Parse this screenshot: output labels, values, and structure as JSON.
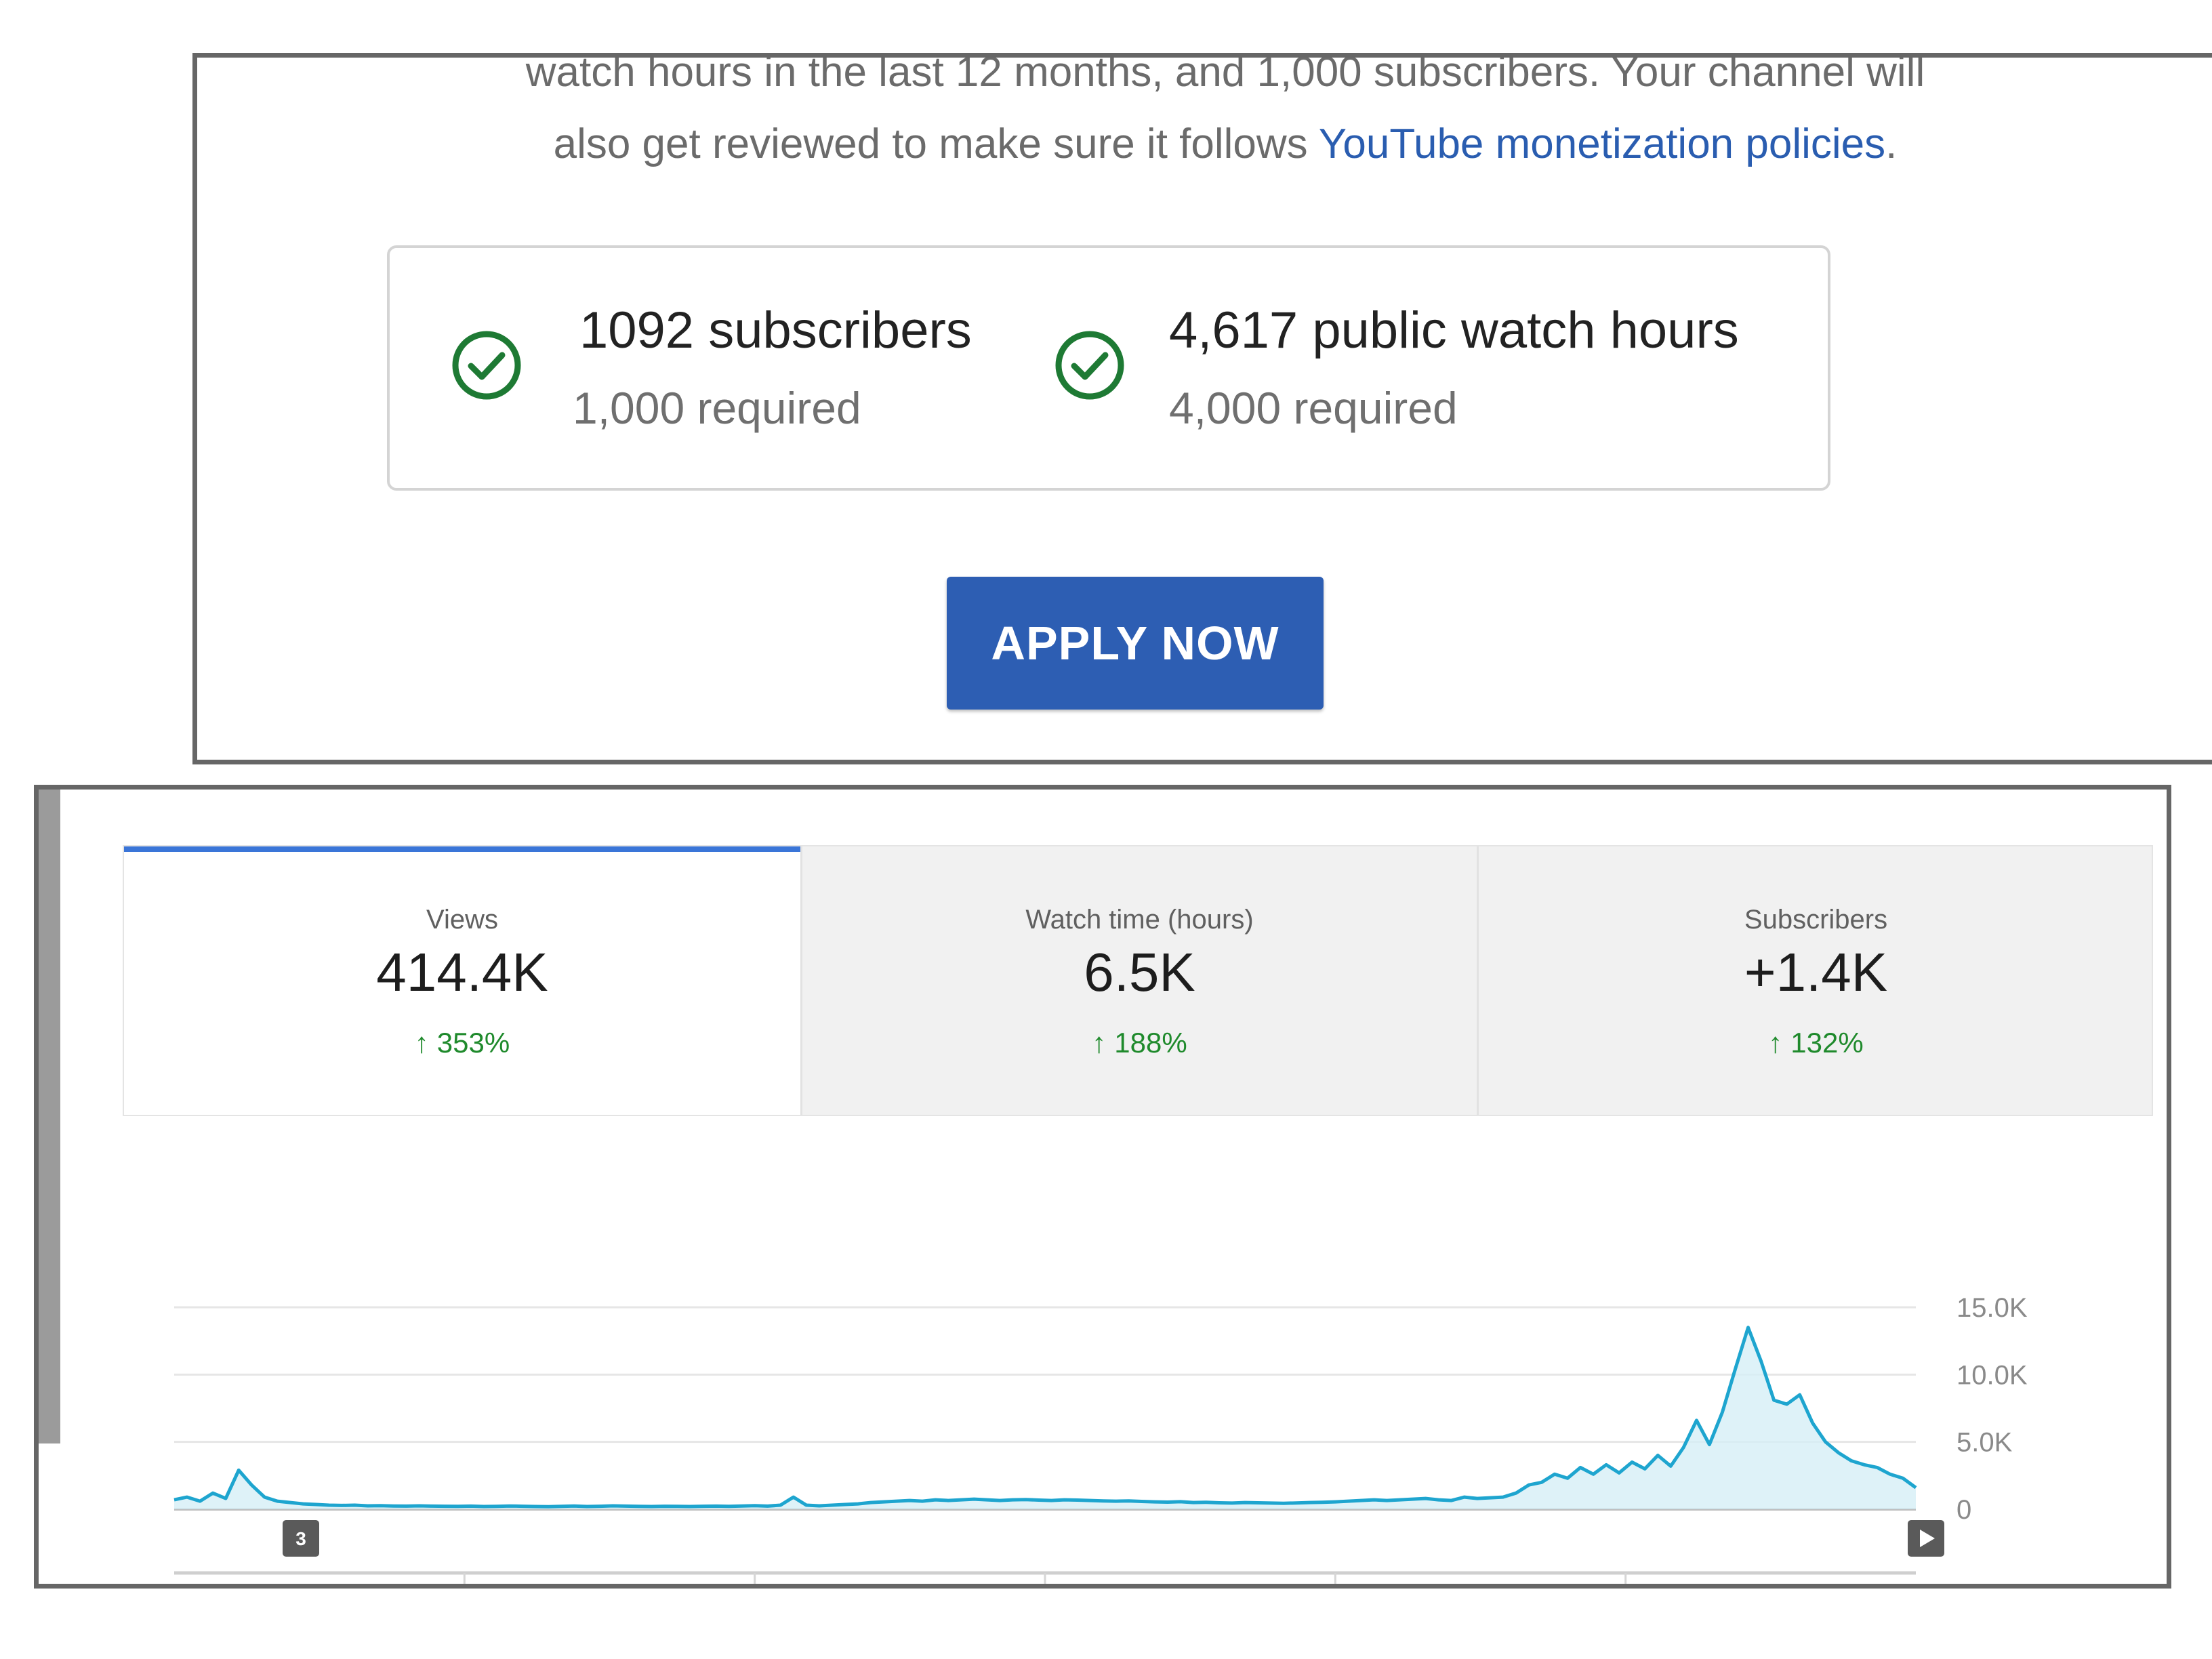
{
  "intro": {
    "line1": "watch hours in the last 12 months, and 1,000 subscribers. Your channel will",
    "line2_prefix": "also get reviewed to make sure it follows ",
    "policy_link": "YouTube monetization policies",
    "line2_suffix": "."
  },
  "requirements": {
    "subscribers": {
      "count": "1092",
      "label": "subscribers",
      "required": "1,000 required",
      "met": true
    },
    "watch_hours": {
      "count": "4,617",
      "label": "public watch hours",
      "required": "4,000 required",
      "met": true
    }
  },
  "apply_button": {
    "label": "APPLY NOW"
  },
  "metric_tabs": [
    {
      "label": "Views",
      "value": "414.4K",
      "change": "353%",
      "selected": true
    },
    {
      "label": "Watch time (hours)",
      "value": "6.5K",
      "change": "188%",
      "selected": false
    },
    {
      "label": "Subscribers",
      "value": "+1.4K",
      "change": "132%",
      "selected": false
    }
  ],
  "chart_markers": {
    "left_badge": "3"
  },
  "colors": {
    "accent_blue": "#2d5eb3",
    "tab_indicator": "#3a75d8",
    "positive_green": "#1f8a2c",
    "check_green": "#1e7a34",
    "chart_line": "#1ea5cf",
    "chart_fill": "#d6eff6"
  },
  "icons": {
    "check": "check-circle-icon",
    "delta": "arrow-up-icon",
    "play": "play-icon"
  },
  "chart_data": {
    "type": "area",
    "title": "",
    "xlabel": "",
    "ylabel": "",
    "yticks": [
      "0",
      "5.0K",
      "10.0K",
      "15.0K"
    ],
    "ylim": [
      0,
      15000
    ],
    "grid": true,
    "y_axis_side": "right",
    "series": [
      {
        "values": [
          700,
          900,
          600,
          1200,
          800,
          2900,
          1800,
          900,
          600,
          500,
          400,
          350,
          300,
          280,
          300,
          250,
          260,
          240,
          230,
          250,
          230,
          220,
          210,
          230,
          200,
          210,
          240,
          220,
          200,
          190,
          210,
          240,
          200,
          220,
          250,
          230,
          210,
          200,
          220,
          210,
          200,
          220,
          230,
          210,
          240,
          260,
          230,
          300,
          900,
          300,
          250,
          300,
          350,
          400,
          500,
          550,
          600,
          650,
          600,
          700,
          650,
          700,
          750,
          700,
          650,
          700,
          720,
          680,
          650,
          700,
          680,
          650,
          620,
          600,
          620,
          580,
          550,
          530,
          560,
          500,
          520,
          480,
          460,
          500,
          480,
          460,
          440,
          470,
          500,
          520,
          550,
          600,
          650,
          700,
          650,
          700,
          750,
          800,
          700,
          650,
          900,
          800,
          850,
          900,
          1200,
          1800,
          2000,
          2600,
          2300,
          3100,
          2600,
          3300,
          2700,
          3500,
          3000,
          4000,
          3200,
          4600,
          6600,
          4800,
          7200,
          10400,
          13500,
          11000,
          8100,
          7800,
          8500,
          6400,
          5000,
          4200,
          3600,
          3300,
          3100,
          2600,
          2300,
          1600
        ]
      }
    ]
  }
}
